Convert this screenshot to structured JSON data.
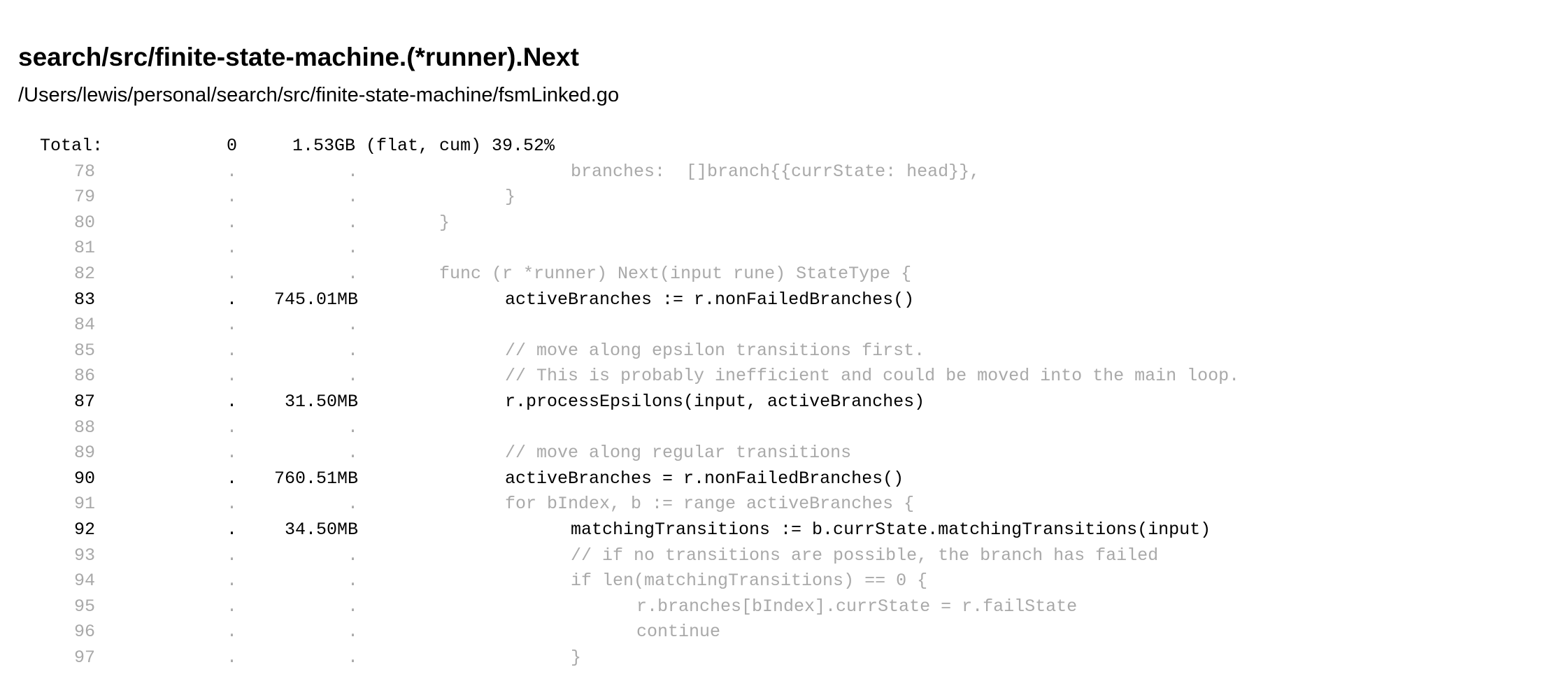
{
  "header": {
    "function_name": "search/src/finite-state-machine.(*runner).Next",
    "file_path": "/Users/lewis/personal/search/src/finite-state-machine/fsmLinked.go"
  },
  "total": {
    "label": "Total:",
    "flat": "0",
    "cum_summary": "1.53GB (flat, cum) 39.52%"
  },
  "rows": [
    {
      "line": "78",
      "flat": ".",
      "cum": ".",
      "code": "\t\t\tbranches:  []branch{{currState: head}},",
      "hot": false
    },
    {
      "line": "79",
      "flat": ".",
      "cum": ".",
      "code": "\t\t}",
      "hot": false
    },
    {
      "line": "80",
      "flat": ".",
      "cum": ".",
      "code": "\t}",
      "hot": false
    },
    {
      "line": "81",
      "flat": ".",
      "cum": ".",
      "code": "",
      "hot": false
    },
    {
      "line": "82",
      "flat": ".",
      "cum": ".",
      "code": "\tfunc (r *runner) Next(input rune) StateType {",
      "hot": false
    },
    {
      "line": "83",
      "flat": ".",
      "cum": "745.01MB",
      "code": "\t\tactiveBranches := r.nonFailedBranches()",
      "hot": true
    },
    {
      "line": "84",
      "flat": ".",
      "cum": ".",
      "code": "",
      "hot": false
    },
    {
      "line": "85",
      "flat": ".",
      "cum": ".",
      "code": "\t\t// move along epsilon transitions first.",
      "hot": false
    },
    {
      "line": "86",
      "flat": ".",
      "cum": ".",
      "code": "\t\t// This is probably inefficient and could be moved into the main loop.",
      "hot": false
    },
    {
      "line": "87",
      "flat": ".",
      "cum": "31.50MB",
      "code": "\t\tr.processEpsilons(input, activeBranches)",
      "hot": true
    },
    {
      "line": "88",
      "flat": ".",
      "cum": ".",
      "code": "",
      "hot": false
    },
    {
      "line": "89",
      "flat": ".",
      "cum": ".",
      "code": "\t\t// move along regular transitions",
      "hot": false
    },
    {
      "line": "90",
      "flat": ".",
      "cum": "760.51MB",
      "code": "\t\tactiveBranches = r.nonFailedBranches()",
      "hot": true
    },
    {
      "line": "91",
      "flat": ".",
      "cum": ".",
      "code": "\t\tfor bIndex, b := range activeBranches {",
      "hot": false
    },
    {
      "line": "92",
      "flat": ".",
      "cum": "34.50MB",
      "code": "\t\t\tmatchingTransitions := b.currState.matchingTransitions(input)",
      "hot": true
    },
    {
      "line": "93",
      "flat": ".",
      "cum": ".",
      "code": "\t\t\t// if no transitions are possible, the branch has failed",
      "hot": false
    },
    {
      "line": "94",
      "flat": ".",
      "cum": ".",
      "code": "\t\t\tif len(matchingTransitions) == 0 {",
      "hot": false
    },
    {
      "line": "95",
      "flat": ".",
      "cum": ".",
      "code": "\t\t\t\tr.branches[bIndex].currState = r.failState",
      "hot": false
    },
    {
      "line": "96",
      "flat": ".",
      "cum": ".",
      "code": "\t\t\t\tcontinue",
      "hot": false
    },
    {
      "line": "97",
      "flat": ".",
      "cum": ".",
      "code": "\t\t\t}",
      "hot": false
    }
  ],
  "colors": {
    "hot_text": "#000000",
    "dim_text": "#a9a9a9",
    "background": "#ffffff"
  }
}
